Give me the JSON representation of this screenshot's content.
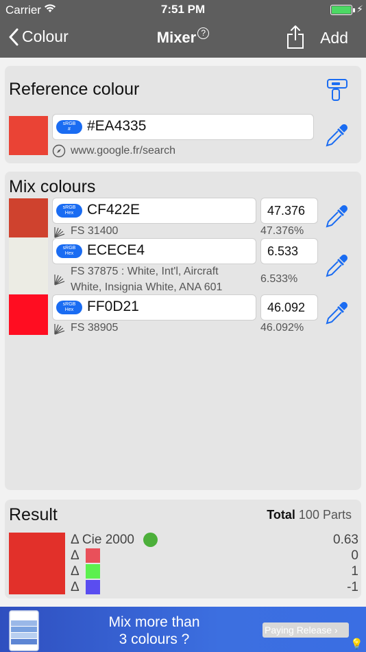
{
  "status": {
    "carrier": "Carrier",
    "time": "7:51 PM"
  },
  "nav": {
    "back_label": "Colour",
    "title": "Mixer",
    "help": "?",
    "add_label": "Add"
  },
  "reference": {
    "heading": "Reference colour",
    "swatch_color": "#EA4335",
    "badge_top": "sRGB",
    "badge_bottom": "#",
    "hex": "#EA4335",
    "source": "www.google.fr/search"
  },
  "mix": {
    "heading": "Mix colours",
    "items": [
      {
        "color": "#CF422E",
        "badge_top": "sRGB",
        "badge_bottom": "Hex",
        "hex": "CF422E",
        "parts": "47.376",
        "name": "FS 31400",
        "percent": "47.376%"
      },
      {
        "color": "#ECECE4",
        "badge_top": "sRGB",
        "badge_bottom": "Hex",
        "hex": "ECECE4",
        "parts": "6.533",
        "name_line1": "FS 37875 : White, Int'l, Aircraft",
        "name_line2": "White, Insignia White, ANA 601",
        "percent": "6.533%"
      },
      {
        "color": "#FF0D21",
        "badge_top": "sRGB",
        "badge_bottom": "Hex",
        "hex": "FF0D21",
        "parts": "46.092",
        "name": "FS 38905",
        "percent": "46.092%"
      }
    ]
  },
  "result": {
    "heading": "Result",
    "total_label": "Total",
    "total_value": "100",
    "total_unit": "Parts",
    "swatch_color": "#E2302A",
    "delta_cie_label": "Δ Cie 2000",
    "delta_cie_value": "0.63",
    "delta_symbol": "Δ",
    "delta_rows": [
      {
        "color": "#E9505A",
        "value": "0"
      },
      {
        "color": "#5CF04E",
        "value": "1"
      },
      {
        "color": "#5A4DF0",
        "value": "-1"
      }
    ],
    "status_color": "#4CAF3A"
  },
  "banner": {
    "line1": "Mix more than",
    "line2": "3 colours ?",
    "release_label": "Paying Release ›"
  }
}
